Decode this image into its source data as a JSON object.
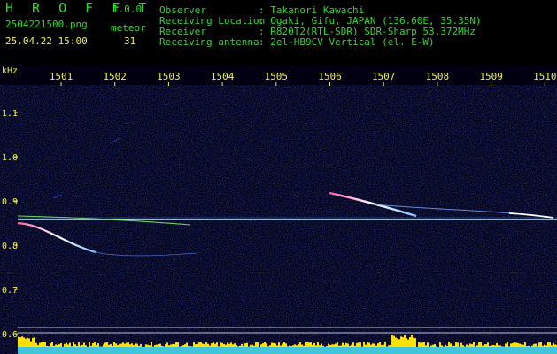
{
  "app": {
    "name": "H R O F F T",
    "version": "1.0.0"
  },
  "file": {
    "name": "2504221500.png",
    "datetime": "25.04.22 15:00"
  },
  "meteor": {
    "label": "meteor",
    "count": "31"
  },
  "info": [
    {
      "label": "Observer",
      "value": ": Takanori Kawachi"
    },
    {
      "label": "Receiving Location",
      "value": ": Ogaki, Gifu, JAPAN (136.60E, 35.35N)"
    },
    {
      "label": "Receiver",
      "value": ": R820T2(RTL-SDR) SDR-Sharp 53.372MHz"
    },
    {
      "label": "Receiving antenna",
      "value": ": 2el-HB9CV Vertical (el. E-W)"
    }
  ],
  "axis": {
    "unit_label": "kHz",
    "x_ticks": [
      "1501",
      "1502",
      "1503",
      "1504",
      "1505",
      "1506",
      "1507",
      "1508",
      "1509",
      "1510"
    ],
    "y_ticks": [
      "1.1",
      "1.0",
      "0.9",
      "0.8",
      "0.7",
      "0.6"
    ]
  },
  "colors": {
    "header_green": "#2fd82f",
    "header_yellow": "#f2f24a",
    "background": "#000010",
    "signal": "#e8f0ff",
    "level": "#ffe000",
    "level_base": "#20c0ff"
  }
}
